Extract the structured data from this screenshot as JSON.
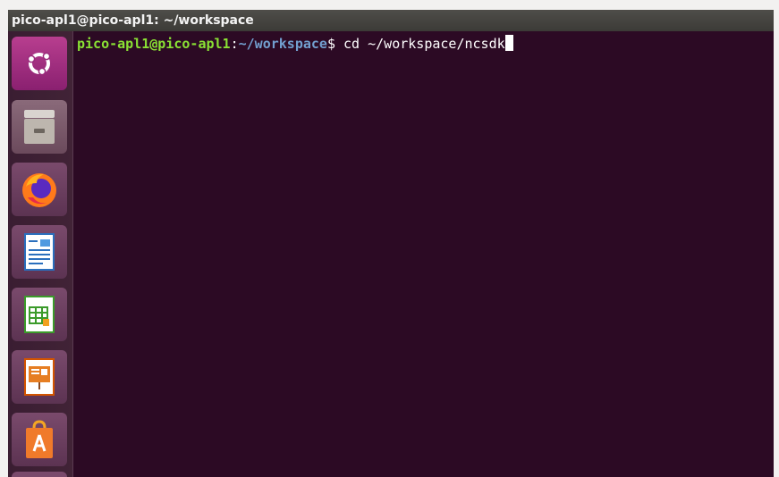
{
  "window": {
    "title": "pico-apl1@pico-apl1: ~/workspace"
  },
  "launcher": {
    "items": [
      {
        "name": "ubuntu-dash",
        "icon": "ubuntu-logo-icon"
      },
      {
        "name": "files",
        "icon": "file-cabinet-icon"
      },
      {
        "name": "firefox",
        "icon": "firefox-icon"
      },
      {
        "name": "libreoffice-writer",
        "icon": "writer-document-icon"
      },
      {
        "name": "libreoffice-calc",
        "icon": "calc-spreadsheet-icon"
      },
      {
        "name": "libreoffice-impress",
        "icon": "impress-presentation-icon"
      },
      {
        "name": "ubuntu-software",
        "icon": "software-bag-icon"
      }
    ]
  },
  "terminal": {
    "user_host": "pico-apl1@pico-apl1",
    "colon": ":",
    "cwd": "~/workspace",
    "prompt_symbol": "$",
    "command": " cd ~/workspace/ncsdk",
    "colors": {
      "background": "#2c0a24",
      "user": "#8ae234",
      "path": "#729fcf",
      "text": "#ffffff"
    }
  }
}
